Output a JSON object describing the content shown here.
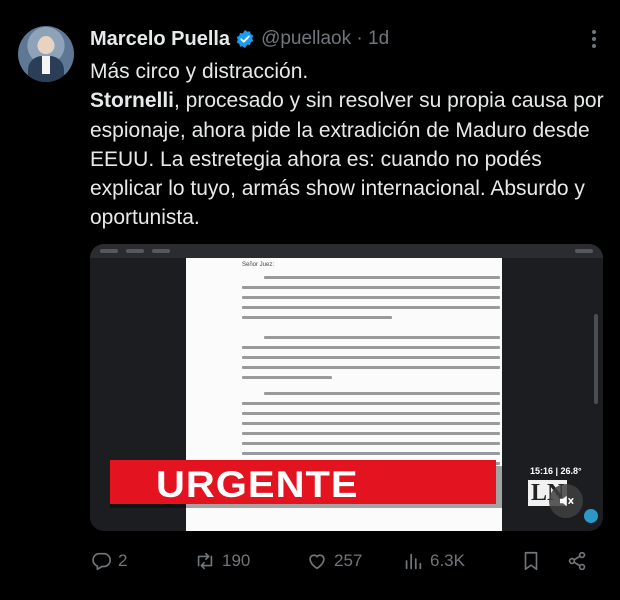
{
  "tweet": {
    "author_name": "Marcelo Puella",
    "handle_time": "@puellaok · 1d",
    "line1": "Más circo y distracción.",
    "bold_name": "Stornelli",
    "body": ", procesado y sin resolver su propia causa por espionaje, ahora pide la extradición de Maduro desde EEUU. La estretegia ahora es: cuando no podés explicar lo tuyo, armás show internacional. Absurdo y oportunista."
  },
  "media": {
    "doc_greeting": "Señor Juez:",
    "banner_text": "URGENTE",
    "clock": "15:16 | 26.8°",
    "channel_logo": "LN"
  },
  "actions": {
    "replies": "2",
    "reposts": "190",
    "likes": "257",
    "views": "6.3K"
  },
  "colors": {
    "background": "#000000",
    "text": "#e7e9ea",
    "muted": "#71767b",
    "verified": "#1d9bf0",
    "banner": "#e3131f"
  },
  "icons": [
    "verified-icon",
    "more-icon",
    "mute-icon",
    "reply-icon",
    "repost-icon",
    "like-icon",
    "views-icon",
    "bookmark-icon",
    "share-icon"
  ]
}
